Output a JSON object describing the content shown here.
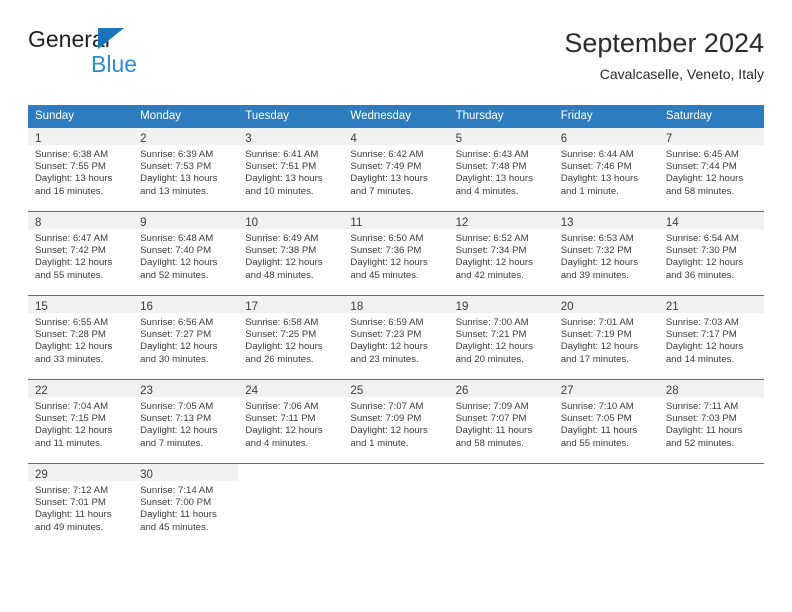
{
  "brand": {
    "name_top": "General",
    "name_bottom": "Blue",
    "mark": "blue-triangle",
    "color_dark": "#231f20",
    "color_blue": "#2e8bd0"
  },
  "header": {
    "title": "September 2024",
    "subtitle": "Cavalcaselle, Veneto, Italy"
  },
  "theme": {
    "header_bg": "#2d7cc0",
    "header_text": "#ffffff",
    "daynum_bg": "#f1f1f1",
    "cell_bg": "#ffffff",
    "text": "#3b3b3b"
  },
  "calendar": {
    "weekday_headers": [
      "Sunday",
      "Monday",
      "Tuesday",
      "Wednesday",
      "Thursday",
      "Friday",
      "Saturday"
    ],
    "weeks": [
      [
        {
          "day": "1",
          "sunrise": "Sunrise: 6:38 AM",
          "sunset": "Sunset: 7:55 PM",
          "daylight1": "Daylight: 13 hours",
          "daylight2": "and 16 minutes."
        },
        {
          "day": "2",
          "sunrise": "Sunrise: 6:39 AM",
          "sunset": "Sunset: 7:53 PM",
          "daylight1": "Daylight: 13 hours",
          "daylight2": "and 13 minutes."
        },
        {
          "day": "3",
          "sunrise": "Sunrise: 6:41 AM",
          "sunset": "Sunset: 7:51 PM",
          "daylight1": "Daylight: 13 hours",
          "daylight2": "and 10 minutes."
        },
        {
          "day": "4",
          "sunrise": "Sunrise: 6:42 AM",
          "sunset": "Sunset: 7:49 PM",
          "daylight1": "Daylight: 13 hours",
          "daylight2": "and 7 minutes."
        },
        {
          "day": "5",
          "sunrise": "Sunrise: 6:43 AM",
          "sunset": "Sunset: 7:48 PM",
          "daylight1": "Daylight: 13 hours",
          "daylight2": "and 4 minutes."
        },
        {
          "day": "6",
          "sunrise": "Sunrise: 6:44 AM",
          "sunset": "Sunset: 7:46 PM",
          "daylight1": "Daylight: 13 hours",
          "daylight2": "and 1 minute."
        },
        {
          "day": "7",
          "sunrise": "Sunrise: 6:45 AM",
          "sunset": "Sunset: 7:44 PM",
          "daylight1": "Daylight: 12 hours",
          "daylight2": "and 58 minutes."
        }
      ],
      [
        {
          "day": "8",
          "sunrise": "Sunrise: 6:47 AM",
          "sunset": "Sunset: 7:42 PM",
          "daylight1": "Daylight: 12 hours",
          "daylight2": "and 55 minutes."
        },
        {
          "day": "9",
          "sunrise": "Sunrise: 6:48 AM",
          "sunset": "Sunset: 7:40 PM",
          "daylight1": "Daylight: 12 hours",
          "daylight2": "and 52 minutes."
        },
        {
          "day": "10",
          "sunrise": "Sunrise: 6:49 AM",
          "sunset": "Sunset: 7:38 PM",
          "daylight1": "Daylight: 12 hours",
          "daylight2": "and 48 minutes."
        },
        {
          "day": "11",
          "sunrise": "Sunrise: 6:50 AM",
          "sunset": "Sunset: 7:36 PM",
          "daylight1": "Daylight: 12 hours",
          "daylight2": "and 45 minutes."
        },
        {
          "day": "12",
          "sunrise": "Sunrise: 6:52 AM",
          "sunset": "Sunset: 7:34 PM",
          "daylight1": "Daylight: 12 hours",
          "daylight2": "and 42 minutes."
        },
        {
          "day": "13",
          "sunrise": "Sunrise: 6:53 AM",
          "sunset": "Sunset: 7:32 PM",
          "daylight1": "Daylight: 12 hours",
          "daylight2": "and 39 minutes."
        },
        {
          "day": "14",
          "sunrise": "Sunrise: 6:54 AM",
          "sunset": "Sunset: 7:30 PM",
          "daylight1": "Daylight: 12 hours",
          "daylight2": "and 36 minutes."
        }
      ],
      [
        {
          "day": "15",
          "sunrise": "Sunrise: 6:55 AM",
          "sunset": "Sunset: 7:28 PM",
          "daylight1": "Daylight: 12 hours",
          "daylight2": "and 33 minutes."
        },
        {
          "day": "16",
          "sunrise": "Sunrise: 6:56 AM",
          "sunset": "Sunset: 7:27 PM",
          "daylight1": "Daylight: 12 hours",
          "daylight2": "and 30 minutes."
        },
        {
          "day": "17",
          "sunrise": "Sunrise: 6:58 AM",
          "sunset": "Sunset: 7:25 PM",
          "daylight1": "Daylight: 12 hours",
          "daylight2": "and 26 minutes."
        },
        {
          "day": "18",
          "sunrise": "Sunrise: 6:59 AM",
          "sunset": "Sunset: 7:23 PM",
          "daylight1": "Daylight: 12 hours",
          "daylight2": "and 23 minutes."
        },
        {
          "day": "19",
          "sunrise": "Sunrise: 7:00 AM",
          "sunset": "Sunset: 7:21 PM",
          "daylight1": "Daylight: 12 hours",
          "daylight2": "and 20 minutes."
        },
        {
          "day": "20",
          "sunrise": "Sunrise: 7:01 AM",
          "sunset": "Sunset: 7:19 PM",
          "daylight1": "Daylight: 12 hours",
          "daylight2": "and 17 minutes."
        },
        {
          "day": "21",
          "sunrise": "Sunrise: 7:03 AM",
          "sunset": "Sunset: 7:17 PM",
          "daylight1": "Daylight: 12 hours",
          "daylight2": "and 14 minutes."
        }
      ],
      [
        {
          "day": "22",
          "sunrise": "Sunrise: 7:04 AM",
          "sunset": "Sunset: 7:15 PM",
          "daylight1": "Daylight: 12 hours",
          "daylight2": "and 11 minutes."
        },
        {
          "day": "23",
          "sunrise": "Sunrise: 7:05 AM",
          "sunset": "Sunset: 7:13 PM",
          "daylight1": "Daylight: 12 hours",
          "daylight2": "and 7 minutes."
        },
        {
          "day": "24",
          "sunrise": "Sunrise: 7:06 AM",
          "sunset": "Sunset: 7:11 PM",
          "daylight1": "Daylight: 12 hours",
          "daylight2": "and 4 minutes."
        },
        {
          "day": "25",
          "sunrise": "Sunrise: 7:07 AM",
          "sunset": "Sunset: 7:09 PM",
          "daylight1": "Daylight: 12 hours",
          "daylight2": "and 1 minute."
        },
        {
          "day": "26",
          "sunrise": "Sunrise: 7:09 AM",
          "sunset": "Sunset: 7:07 PM",
          "daylight1": "Daylight: 11 hours",
          "daylight2": "and 58 minutes."
        },
        {
          "day": "27",
          "sunrise": "Sunrise: 7:10 AM",
          "sunset": "Sunset: 7:05 PM",
          "daylight1": "Daylight: 11 hours",
          "daylight2": "and 55 minutes."
        },
        {
          "day": "28",
          "sunrise": "Sunrise: 7:11 AM",
          "sunset": "Sunset: 7:03 PM",
          "daylight1": "Daylight: 11 hours",
          "daylight2": "and 52 minutes."
        }
      ],
      [
        {
          "day": "29",
          "sunrise": "Sunrise: 7:12 AM",
          "sunset": "Sunset: 7:01 PM",
          "daylight1": "Daylight: 11 hours",
          "daylight2": "and 49 minutes."
        },
        {
          "day": "30",
          "sunrise": "Sunrise: 7:14 AM",
          "sunset": "Sunset: 7:00 PM",
          "daylight1": "Daylight: 11 hours",
          "daylight2": "and 45 minutes."
        },
        {
          "day": "",
          "sunrise": "",
          "sunset": "",
          "daylight1": "",
          "daylight2": ""
        },
        {
          "day": "",
          "sunrise": "",
          "sunset": "",
          "daylight1": "",
          "daylight2": ""
        },
        {
          "day": "",
          "sunrise": "",
          "sunset": "",
          "daylight1": "",
          "daylight2": ""
        },
        {
          "day": "",
          "sunrise": "",
          "sunset": "",
          "daylight1": "",
          "daylight2": ""
        },
        {
          "day": "",
          "sunrise": "",
          "sunset": "",
          "daylight1": "",
          "daylight2": ""
        }
      ]
    ]
  }
}
